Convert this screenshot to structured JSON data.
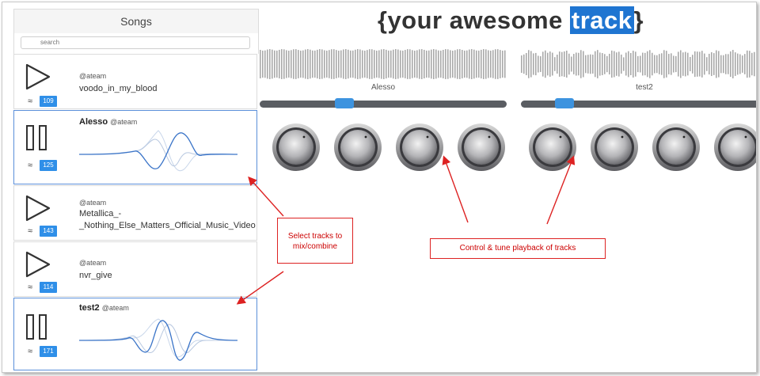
{
  "sidebar": {
    "title": "Songs",
    "search_placeholder": "search",
    "songs": [
      {
        "user": "@ateam",
        "title": "voodo_in_my_blood",
        "count": "109",
        "state": "play"
      },
      {
        "name": "Alesso",
        "user": "@ateam",
        "count": "125",
        "state": "pause"
      },
      {
        "user": "@ateam",
        "title_line1": "Metallica_-",
        "title_line2": "_Nothing_Else_Matters_Official_Music_Video",
        "count": "143",
        "state": "play"
      },
      {
        "user": "@ateam",
        "title": "nvr_give",
        "count": "114",
        "state": "play"
      },
      {
        "name": "test2",
        "user": "@ateam",
        "count": "171",
        "state": "pause"
      }
    ]
  },
  "main": {
    "title_prefix": "{your awesome ",
    "title_highlight": "track",
    "title_suffix": "}"
  },
  "decks": [
    {
      "label": "Alesso",
      "position": 0.33
    },
    {
      "label": "test2",
      "position": 0.15
    }
  ],
  "annotations": {
    "select": "Select tracks to mix/combine",
    "control": "Control & tune playback of tracks"
  },
  "colors": {
    "accent": "#2f8fe8",
    "annotation": "#dd2222",
    "slider": "#5a5d62"
  }
}
